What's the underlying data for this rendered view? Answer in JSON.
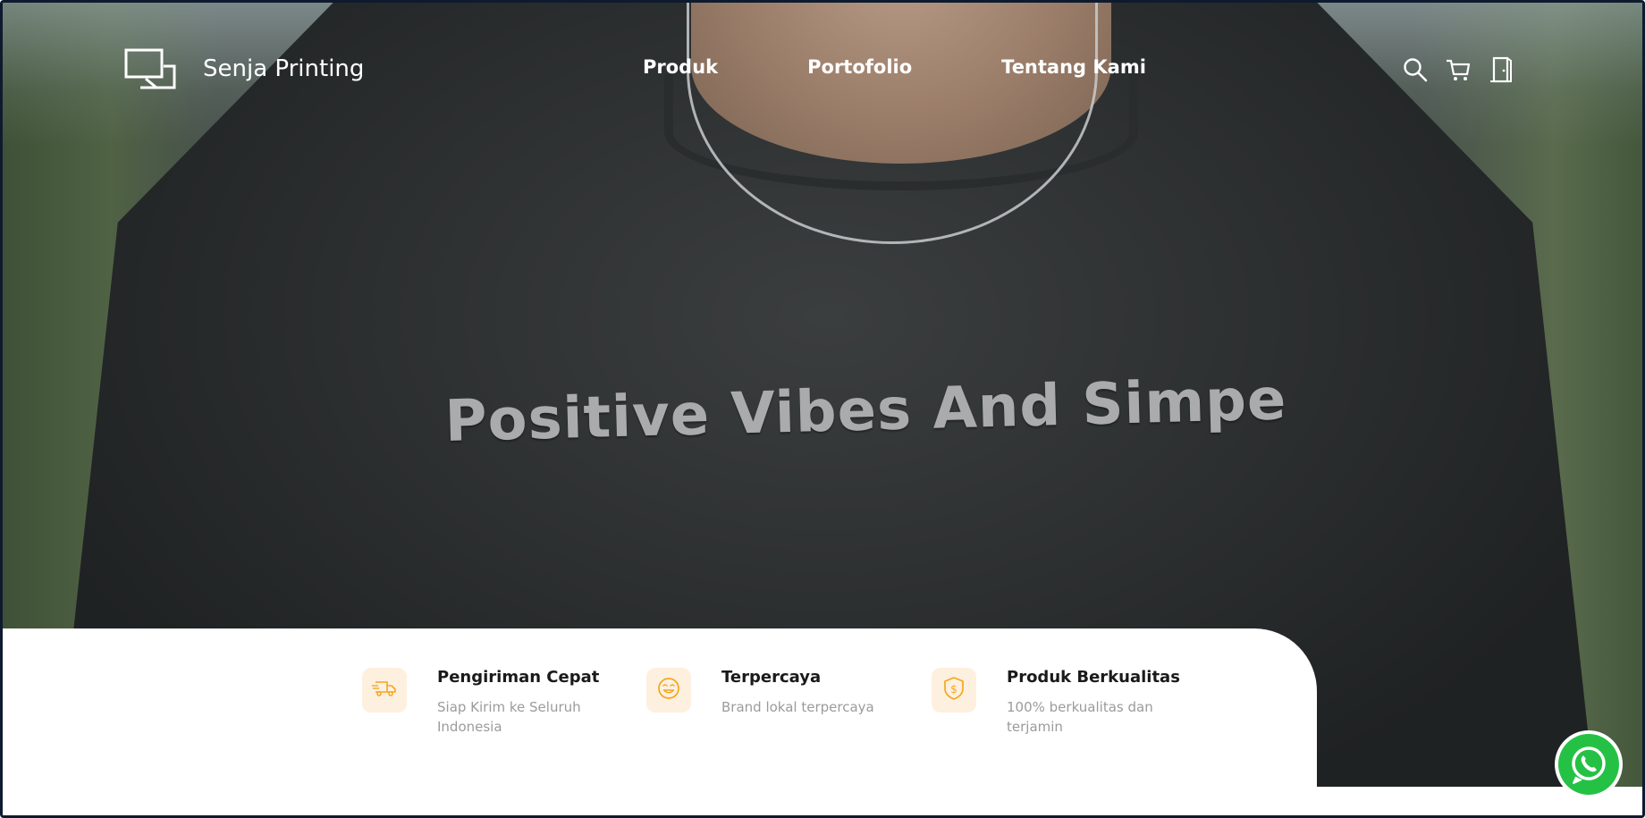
{
  "brand": {
    "name": "Senja Printing"
  },
  "nav": {
    "links": [
      {
        "label": "Produk"
      },
      {
        "label": "Portofolio"
      },
      {
        "label": "Tentang Kami"
      }
    ],
    "icons": [
      "search-icon",
      "cart-icon",
      "door-icon"
    ]
  },
  "hero": {
    "shirt_text": "Positive Vibes And Simpe"
  },
  "features": [
    {
      "icon": "truck-icon",
      "title": "Pengiriman Cepat",
      "description": "Siap Kirim ke Seluruh Indonesia"
    },
    {
      "icon": "smile-icon",
      "title": "Terpercaya",
      "description": "Brand lokal terpercaya"
    },
    {
      "icon": "shield-dollar-icon",
      "title": "Produk Berkualitas",
      "description": "100% berkualitas dan terjamin"
    }
  ],
  "whatsapp": {
    "icon": "whatsapp-icon"
  },
  "colors": {
    "accent": "#f5a623",
    "feature_icon_bg": "#fdf0de",
    "whatsapp_green": "#25c144",
    "nav_text": "#ffffff"
  }
}
